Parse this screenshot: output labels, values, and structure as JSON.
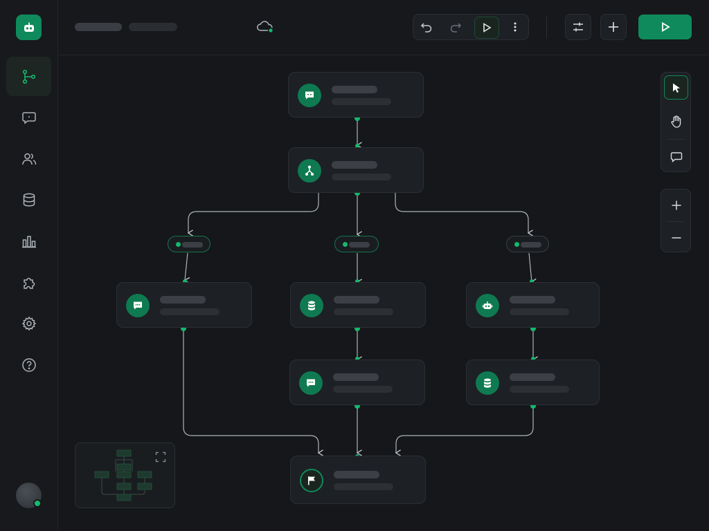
{
  "app": {
    "logo": "robot-icon",
    "sync_status": "cloud-synced-icon"
  },
  "colors": {
    "accent": "#0f8a5c",
    "accent_bright": "#14b86e",
    "background": "#15171a",
    "panel": "#1d2024"
  },
  "sidebar": {
    "items": [
      {
        "name": "workflow",
        "icon": "flow-graph-icon",
        "active": true
      },
      {
        "name": "chat",
        "icon": "chat-bubble-icon"
      },
      {
        "name": "users",
        "icon": "users-icon"
      },
      {
        "name": "database",
        "icon": "database-icon"
      },
      {
        "name": "analytics",
        "icon": "bar-chart-icon"
      },
      {
        "name": "plugins",
        "icon": "puzzle-icon"
      },
      {
        "name": "settings",
        "icon": "gear-icon"
      },
      {
        "name": "help",
        "icon": "help-circle-icon"
      }
    ],
    "user": {
      "icon": "avatar",
      "status": "online"
    }
  },
  "toolbar": {
    "undo": "undo-icon",
    "redo": "redo-icon",
    "play": "play-icon",
    "more": "more-vertical-icon",
    "adjust": "sliders-icon",
    "add": "plus-icon",
    "run": "play-icon"
  },
  "canvas_tools": {
    "select": "cursor-icon",
    "pan": "hand-icon",
    "comment": "comment-icon",
    "zoom_in": "plus-icon",
    "zoom_out": "minus-icon"
  },
  "nodes": [
    {
      "id": "start",
      "icon": "message-icon"
    },
    {
      "id": "router",
      "icon": "branch-icon"
    },
    {
      "id": "left-message",
      "icon": "message-icon"
    },
    {
      "id": "center-database",
      "icon": "database-icon"
    },
    {
      "id": "right-bot",
      "icon": "robot-icon"
    },
    {
      "id": "center-message",
      "icon": "message-icon"
    },
    {
      "id": "right-database",
      "icon": "database-icon"
    },
    {
      "id": "end",
      "icon": "flag-icon"
    }
  ],
  "conditions": [
    {
      "id": "branch-left",
      "active": true
    },
    {
      "id": "branch-center",
      "active": true
    },
    {
      "id": "branch-right",
      "active": false
    }
  ],
  "minimap": {
    "expand": "expand-icon"
  }
}
